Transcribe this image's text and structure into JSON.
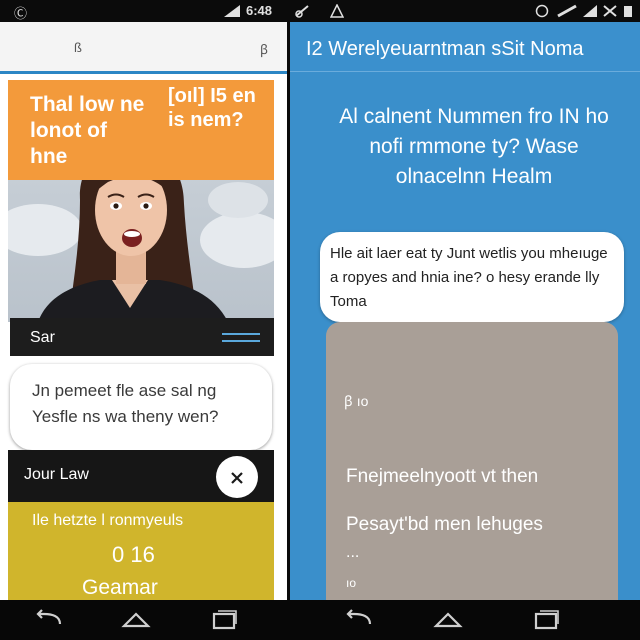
{
  "status_bar": {
    "left_glyph": "Ⓒ",
    "clock": "6:48",
    "icons": [
      "wifi-icon",
      "signal-icon",
      "battery-icon",
      "signal-icon",
      "wifi-icon"
    ]
  },
  "left_screen": {
    "toolbar": {
      "mark_left": "ß",
      "mark_right": "ꞵ"
    },
    "hero": {
      "banner_text": "Thal low ne lonot of hne",
      "badge_text": "[oıl] I5 en is nem?",
      "colors": {
        "banner": "#f39a3b",
        "sky": "#cfd6dd"
      }
    },
    "card_one": {
      "label": "Sar"
    },
    "bubble": {
      "text": "Jn pemeet fle ase sal ng Yesfle ns wa theny wen?"
    },
    "card_two": {
      "label": "Jour Law"
    },
    "yellow_card": {
      "line1": "Ile hetzte l ronmyeuls",
      "line2": "0 16",
      "line3": "Geamar",
      "color": "#d0b52c"
    }
  },
  "right_screen": {
    "header_title": "I2 Werelyeuarntman sSit Noma",
    "heading": "Al calnent Nummen fro IN ho nofi rmmone ty? Wase olnacelnn Healm",
    "bubble": {
      "text": "Hle ait laer eat ty Junt wetlis you mheıuge a ropyes and hnia ine? o hesy erande lly Toma"
    },
    "panel": {
      "icon_label": "ꞵ ıo",
      "line1": "Fnejmeelnyoott vt then",
      "line2": "Pesayt'bd men lehuges",
      "line3": "...",
      "line4": "ıo"
    },
    "colors": {
      "background": "#3a8fcb",
      "panel": "#a99f97"
    }
  },
  "nav_bar": {
    "buttons": [
      "back-icon",
      "home-icon",
      "recents-icon",
      "back-icon",
      "home-icon",
      "recents-icon"
    ]
  }
}
